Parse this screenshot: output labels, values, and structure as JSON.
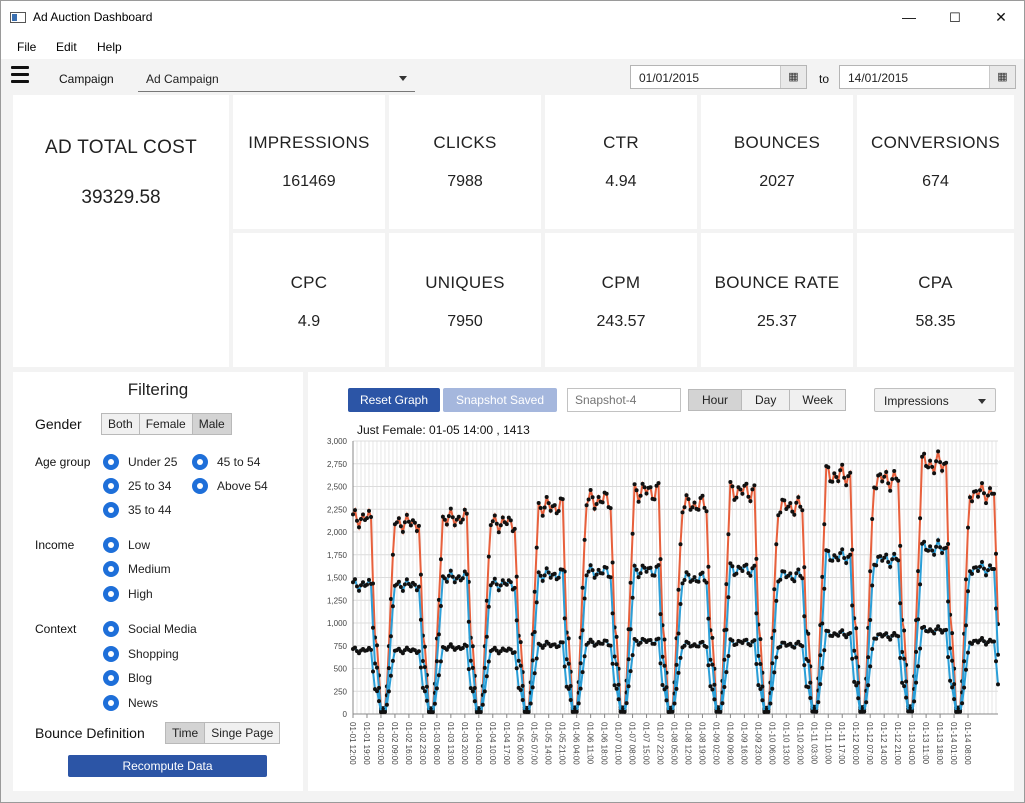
{
  "window": {
    "title": "Ad Auction Dashboard",
    "minimize": "—",
    "maximize": "☐",
    "close": "✕"
  },
  "menu": [
    "File",
    "Edit",
    "Help"
  ],
  "toolbar": {
    "campaign_label": "Campaign",
    "campaign_value": "Ad Campaign",
    "start_date": "01/01/2015",
    "to_label": "to",
    "end_date": "14/01/2015",
    "calendar_icon": "calendar-icon"
  },
  "metrics": {
    "total_cost": {
      "label": "AD TOTAL COST",
      "value": "39329.58"
    },
    "impressions": {
      "label": "IMPRESSIONS",
      "value": "161469"
    },
    "clicks": {
      "label": "CLICKS",
      "value": "7988"
    },
    "ctr": {
      "label": "CTR",
      "value": "4.94"
    },
    "bounces": {
      "label": "BOUNCES",
      "value": "2027"
    },
    "conversions": {
      "label": "CONVERSIONS",
      "value": "674"
    },
    "cpc": {
      "label": "CPC",
      "value": "4.9"
    },
    "uniques": {
      "label": "UNIQUES",
      "value": "7950"
    },
    "cpm": {
      "label": "CPM",
      "value": "243.57"
    },
    "bounce_rate": {
      "label": "BOUNCE RATE",
      "value": "25.37"
    },
    "cpa": {
      "label": "CPA",
      "value": "58.35"
    }
  },
  "filtering": {
    "title": "Filtering",
    "gender_label": "Gender",
    "gender_options": [
      "Both",
      "Female",
      "Male"
    ],
    "gender_selected": "Male",
    "age_label": "Age group",
    "age_options": [
      "Under 25",
      "45 to 54",
      "25 to 34",
      "Above 54",
      "35 to 44"
    ],
    "income_label": "Income",
    "income_options": [
      "Low",
      "Medium",
      "High"
    ],
    "context_label": "Context",
    "context_options": [
      "Social Media",
      "Shopping",
      "Blog",
      "News"
    ],
    "bounce_label": "Bounce Definition",
    "bounce_options": [
      "Time",
      "Singe Page"
    ],
    "bounce_selected": "Time",
    "recompute": "Recompute Data"
  },
  "graph_controls": {
    "reset": "Reset Graph",
    "snapshot_saved": "Snapshot Saved",
    "snapshot_placeholder": "Snapshot-4",
    "granularity": [
      "Hour",
      "Day",
      "Week"
    ],
    "granularity_selected": "Hour",
    "metric_select": "Impressions",
    "tooltip": "Just Female: 01-05 14:00 , 1413"
  },
  "colors": {
    "accent": "#2c55a6",
    "series_all": "#e8603c",
    "series_female": "#2a9fd8",
    "series_male": "#222222"
  },
  "chart_data": {
    "type": "line",
    "ylim": [
      0,
      3000
    ],
    "yticks": [
      "0",
      "250",
      "500",
      "750",
      "1,000",
      "1,250",
      "1,500",
      "1,750",
      "2,000",
      "2,250",
      "2,500",
      "2,750",
      "3,000"
    ],
    "xtick_labels": [
      "01-01 12:00",
      "01-01 19:00",
      "01-02 02:00",
      "01-02 09:00",
      "01-02 16:00",
      "01-02 23:00",
      "01-03 06:00",
      "01-03 13:00",
      "01-03 20:00",
      "01-04 03:00",
      "01-04 10:00",
      "01-04 17:00",
      "01-05 00:00",
      "01-05 07:00",
      "01-05 14:00",
      "01-05 21:00",
      "01-06 04:00",
      "01-06 11:00",
      "01-06 18:00",
      "01-07 01:00",
      "01-07 08:00",
      "01-07 15:00",
      "01-07 22:00",
      "01-08 05:00",
      "01-08 12:00",
      "01-08 19:00",
      "01-09 02:00",
      "01-09 09:00",
      "01-09 16:00",
      "01-09 23:00",
      "01-10 06:00",
      "01-10 13:00",
      "01-10 20:00",
      "01-11 03:00",
      "01-11 10:00",
      "01-11 17:00",
      "01-12 00:00",
      "01-12 07:00",
      "01-12 14:00",
      "01-12 21:00",
      "01-13 04:00",
      "01-13 11:00",
      "01-13 18:00",
      "01-14 01:00",
      "01-14 08:00"
    ],
    "day_peaks": {
      "all": [
        2150,
        2100,
        2150,
        2100,
        2280,
        2350,
        2450,
        2300,
        2450,
        2280,
        2620,
        2580,
        2750,
        2430
      ],
      "female": [
        1420,
        1420,
        1500,
        1430,
        1530,
        1560,
        1580,
        1490,
        1590,
        1520,
        1730,
        1700,
        1820,
        1600
      ],
      "male": [
        700,
        700,
        730,
        700,
        760,
        780,
        800,
        760,
        790,
        760,
        880,
        860,
        920,
        800
      ]
    },
    "series": [
      {
        "key": "all",
        "color": "#e8603c"
      },
      {
        "key": "female",
        "color": "#2a9fd8"
      },
      {
        "key": "male",
        "color": "#2a9fd8"
      }
    ]
  }
}
